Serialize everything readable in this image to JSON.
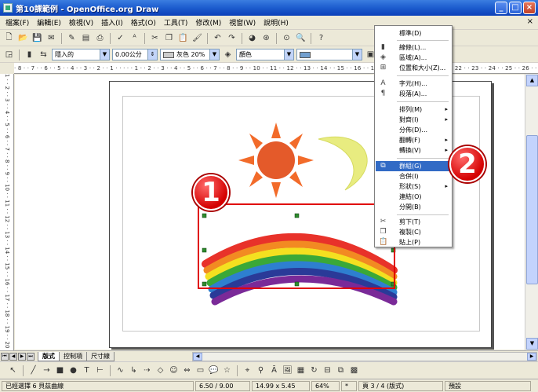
{
  "window": {
    "title": "第10課範例 - OpenOffice.org Draw",
    "minimize_label": "_",
    "maximize_label": "□",
    "close_label": "×"
  },
  "menubar": {
    "items": [
      "檔案(F)",
      "編輯(E)",
      "檢視(V)",
      "插入(I)",
      "格式(O)",
      "工具(T)",
      "修改(M)",
      "視窗(W)",
      "說明(H)"
    ],
    "doc_close": "×"
  },
  "line_toolbar": {
    "line_style": "隱入的",
    "line_width": "0.00公分",
    "line_color": "灰色 20%",
    "area_style": "顏色",
    "area_color": ""
  },
  "ruler_h": "· 8 · · 7 · · 6 · · 5 · · 4 · · 3 · · 2 · · 1 · · · · · 1 · · 2 · · 3 · · 4 · · 5 · · 6 · · 7 · · 8 · · 9 · · 10 · · 11 · · 12 · · 13 · · 14 · · 15 · · 16 · · 17 · · 18 · · 19 · · 20 · · 21 · · 22 · · 23 · · 24 · · 25 · · 26 · · 27 · · 28 · · 29 · · 30 · · 31 · · 32",
  "ruler_v": "1 · · 2 · · 3 · · 4 · · 5 · · 6 · · 7 · · 8 · · 9 · · 10 · · 11 · · 12 · · 13 · · 14 · · 15 · · 16 · · 17 · · 18 · · 19 · · 20",
  "tabs": {
    "items": [
      "版式",
      "控制項",
      "尺寸線"
    ]
  },
  "context_menu": {
    "items": [
      {
        "label": "標準(D)",
        "icon": "none",
        "submenu": false
      },
      {
        "label": "線條(L)...",
        "icon": "line-icon",
        "submenu": false
      },
      {
        "label": "區域(A)...",
        "icon": "area-fill-icon",
        "submenu": false
      },
      {
        "label": "位置和大小(Z)...",
        "icon": "position-size-icon",
        "submenu": false
      },
      {
        "label": "字元(H)...",
        "icon": "character-icon",
        "submenu": false
      },
      {
        "label": "段落(A)...",
        "icon": "paragraph-icon",
        "submenu": false
      },
      {
        "label": "排列(M)",
        "icon": "none",
        "submenu": true
      },
      {
        "label": "對齊(I)",
        "icon": "none",
        "submenu": true
      },
      {
        "label": "分佈(D)...",
        "icon": "none",
        "submenu": false
      },
      {
        "label": "翻轉(F)",
        "icon": "none",
        "submenu": true
      },
      {
        "label": "轉換(V)",
        "icon": "none",
        "submenu": true
      },
      {
        "label": "群組(G)",
        "icon": "group-icon",
        "submenu": false,
        "highlighted": true
      },
      {
        "label": "合併(I)",
        "icon": "none",
        "submenu": false
      },
      {
        "label": "形狀(S)",
        "icon": "none",
        "submenu": true
      },
      {
        "label": "連結(O)",
        "icon": "none",
        "submenu": false
      },
      {
        "label": "分開(B)",
        "icon": "none",
        "submenu": false
      },
      {
        "label": "剪下(T)",
        "icon": "cut-icon",
        "submenu": false
      },
      {
        "label": "複製(C)",
        "icon": "copy-icon",
        "submenu": false
      },
      {
        "label": "貼上(P)",
        "icon": "paste-icon",
        "submenu": false
      }
    ]
  },
  "callouts": {
    "one": "1",
    "two": "2"
  },
  "statusbar": {
    "selection": "已經選擇 6 貝茲曲線",
    "position": "6.50 / 9.00",
    "size": "14.99 x 5.45",
    "zoom": "64%",
    "modified": "*",
    "page": "頁 3 / 4 (版式)",
    "layout": "預設"
  },
  "colors": {
    "titlebar": "#1f5fd0",
    "highlight": "#316ac5",
    "callout": "#d40000",
    "selection_rect": "#e00000",
    "sun": "#f26b2a",
    "moon": "#e8ec80"
  }
}
